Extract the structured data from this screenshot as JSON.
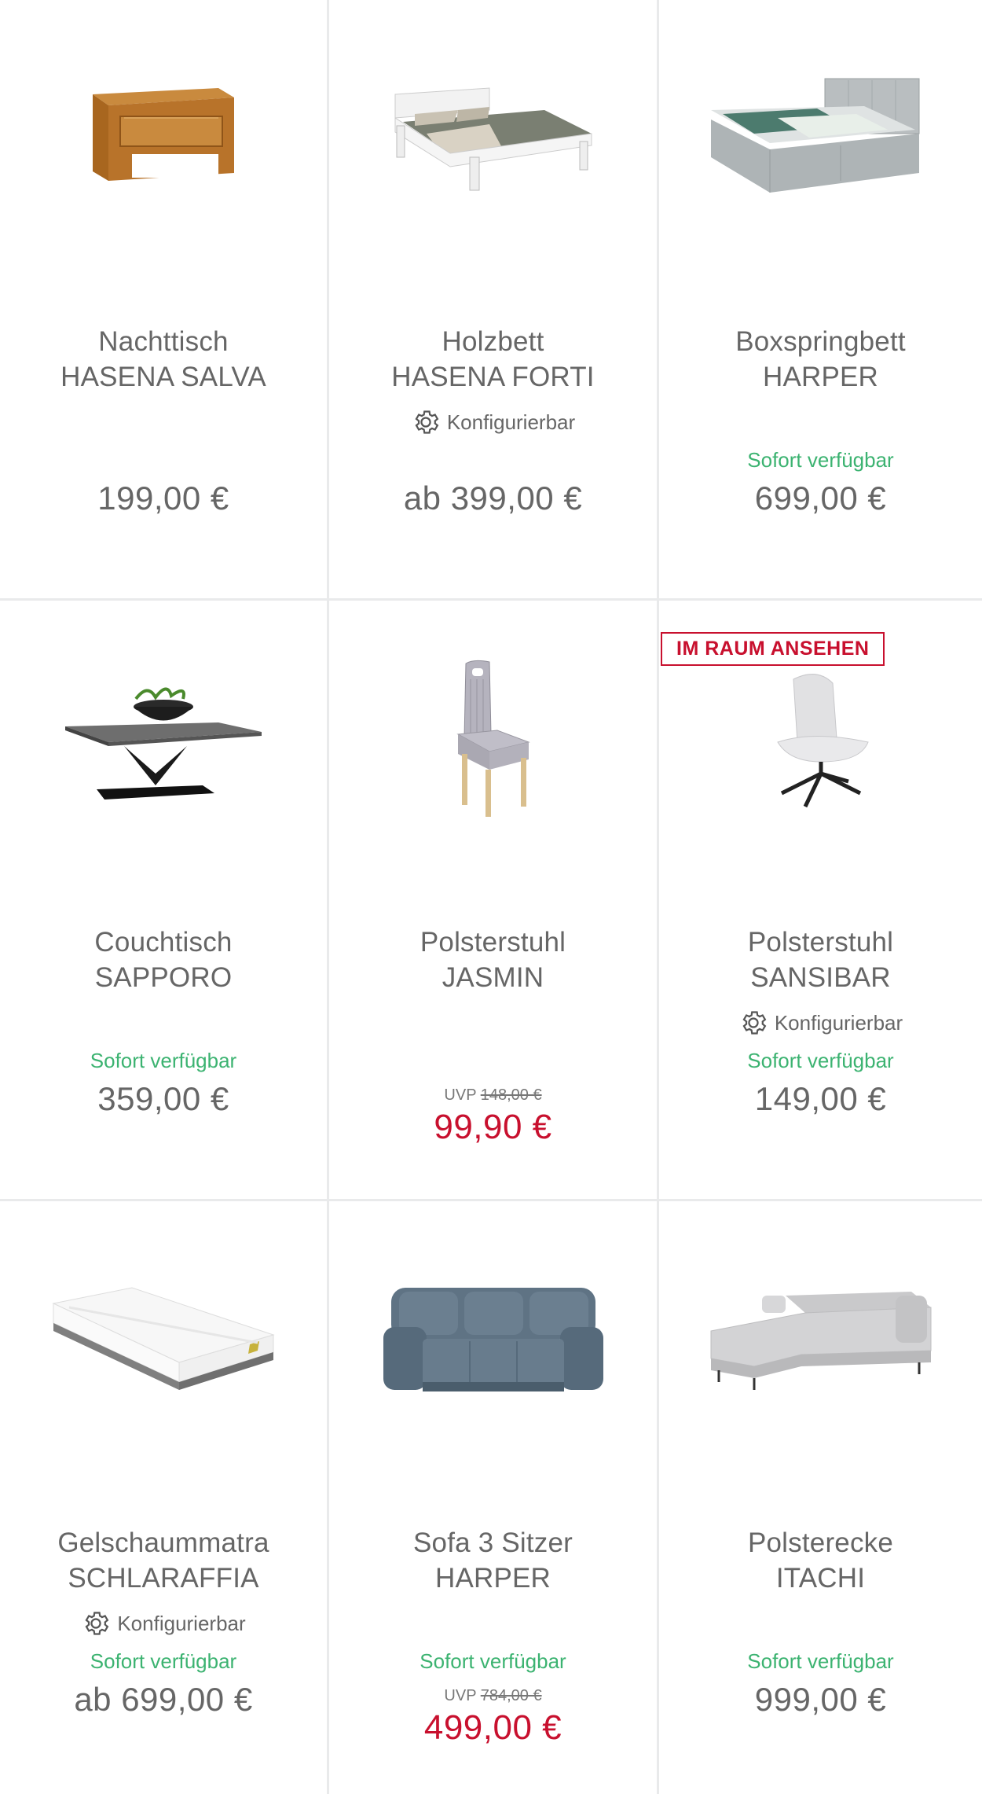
{
  "products": [
    {
      "title1": "Nachttisch",
      "title2": "HASENA SALVA",
      "price": "199,00 €",
      "image": "nightstand"
    },
    {
      "title1": "Holzbett",
      "title2": "HASENA FORTI",
      "config": "Konfigurierbar",
      "price": "ab 399,00 €",
      "image": "bed"
    },
    {
      "title1": "Boxspringbett",
      "title2": "HARPER",
      "availability": "Sofort verfügbar",
      "price": "699,00 €",
      "image": "boxspring-bed"
    },
    {
      "title1": "Couchtisch",
      "title2": "SAPPORO",
      "availability": "Sofort verfügbar",
      "price": "359,00 €",
      "image": "coffee-table"
    },
    {
      "title1": "Polsterstuhl",
      "title2": "JASMIN",
      "uvp_label": "UVP",
      "uvp_old": "148,00 €",
      "sale_price": "99,90 €",
      "image": "chair"
    },
    {
      "title1": "Polsterstuhl",
      "title2": "SANSIBAR",
      "badge": "IM RAUM ANSEHEN",
      "config": "Konfigurierbar",
      "availability": "Sofort verfügbar",
      "price": "149,00 €",
      "image": "swivel-chair"
    },
    {
      "title1": "Gelschaummatra",
      "title2": "SCHLARAFFIA",
      "config": "Konfigurierbar",
      "availability": "Sofort verfügbar",
      "price": "ab 699,00 €",
      "image": "mattress"
    },
    {
      "title1": "Sofa 3 Sitzer",
      "title2": "HARPER",
      "availability": "Sofort verfügbar",
      "uvp_label": "UVP",
      "uvp_old": "784,00 €",
      "sale_price": "499,00 €",
      "image": "sofa"
    },
    {
      "title1": "Polsterecke",
      "title2": "ITACHI",
      "availability": "Sofort verfügbar",
      "price": "999,00 €",
      "image": "corner-sofa"
    }
  ],
  "colors": {
    "availability": "#3cb371",
    "sale": "#c8102e",
    "text": "#666666",
    "divider": "#e9eaeb"
  }
}
